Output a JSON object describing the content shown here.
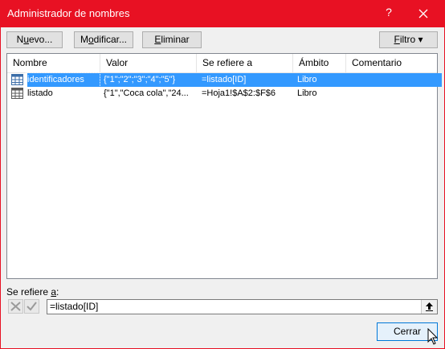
{
  "window": {
    "title": "Administrador de nombres",
    "help_label": "?"
  },
  "toolbar": {
    "new_prefix": "N",
    "new_underline": "u",
    "new_suffix": "evo...",
    "edit_prefix": "M",
    "edit_underline": "o",
    "edit_suffix": "dificar...",
    "delete_underline": "E",
    "delete_suffix": "liminar",
    "filter_underline": "F",
    "filter_suffix": "iltro ▾"
  },
  "table": {
    "columns": [
      "Nombre",
      "Valor",
      "Se refiere a",
      "Ámbito",
      "Comentario"
    ],
    "rows": [
      {
        "name": "identificadores",
        "value": "{\"1\";\"2\";\"3\";\"4\";\"5\"}",
        "refers_to": "=listado[ID]",
        "scope": "Libro",
        "comment": "",
        "selected": true
      },
      {
        "name": "listado",
        "value": "{\"1\",\"Coca cola\",\"24...",
        "refers_to": "=Hoja1!$A$2:$F$6",
        "scope": "Libro",
        "comment": "",
        "selected": false
      }
    ]
  },
  "refers_to_label_prefix": "Se refiere ",
  "refers_to_label_underline": "a",
  "refers_to_label_suffix": ":",
  "refers_to_value": "=listado[ID]",
  "close_button_label": "Cerrar",
  "colors": {
    "titlebar": "#e81123",
    "selection": "#3399ff"
  }
}
